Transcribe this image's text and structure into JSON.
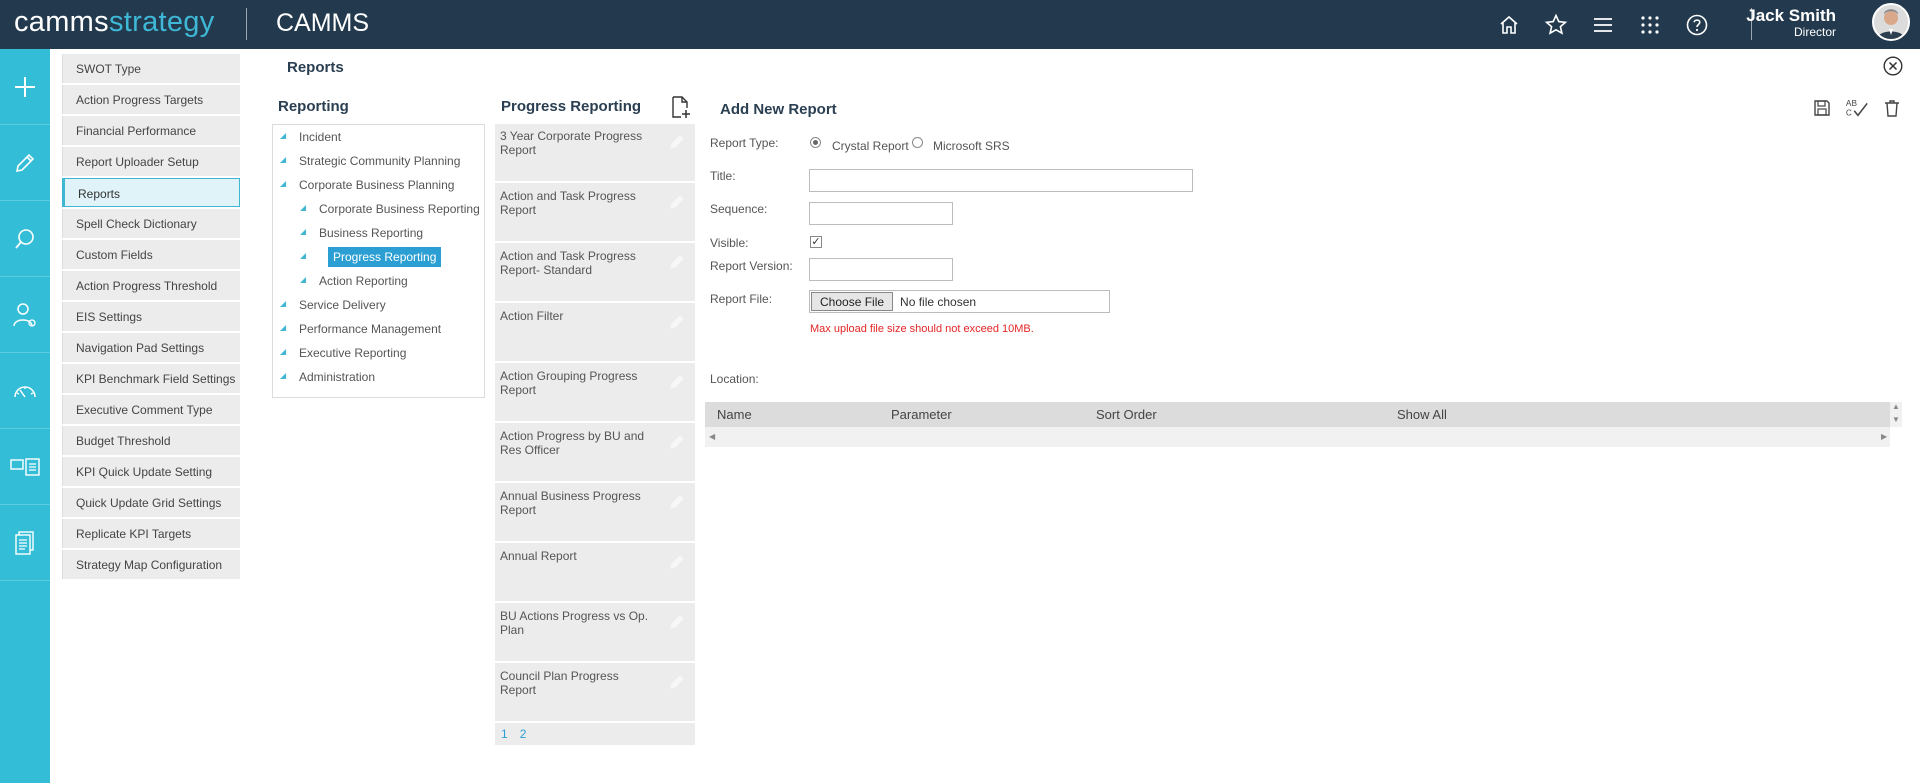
{
  "header": {
    "brand_part1": "camms",
    "brand_part2": "strategy",
    "app_name": "CAMMS",
    "user_name": "Jack Smith",
    "user_role": "Director",
    "icons": [
      "home-icon",
      "star-icon",
      "menu-icon",
      "apps-grid-icon",
      "help-icon"
    ]
  },
  "rail": {
    "icons": [
      "plus-icon",
      "pencil-icon",
      "search-icon",
      "user-settings-icon",
      "gauge-icon",
      "cards-icon",
      "document-icon"
    ]
  },
  "settings_menu": {
    "items": [
      {
        "label": "SWOT Type",
        "active": false
      },
      {
        "label": "Action Progress Targets",
        "active": false
      },
      {
        "label": "Financial Performance",
        "active": false
      },
      {
        "label": "Report Uploader Setup",
        "active": false
      },
      {
        "label": "Reports",
        "active": true
      },
      {
        "label": "Spell Check Dictionary",
        "active": false
      },
      {
        "label": "Custom Fields",
        "active": false
      },
      {
        "label": "Action Progress Threshold",
        "active": false
      },
      {
        "label": "EIS Settings",
        "active": false
      },
      {
        "label": "Navigation Pad Settings",
        "active": false
      },
      {
        "label": "KPI Benchmark Field Settings",
        "active": false
      },
      {
        "label": "Executive Comment Type",
        "active": false
      },
      {
        "label": "Budget Threshold",
        "active": false
      },
      {
        "label": "KPI Quick Update Setting",
        "active": false
      },
      {
        "label": "Quick Update Grid Settings",
        "active": false
      },
      {
        "label": "Replicate KPI Targets",
        "active": false
      },
      {
        "label": "Strategy Map Configuration",
        "active": false
      }
    ]
  },
  "page": {
    "title": "Reports"
  },
  "reporting_tree": {
    "title": "Reporting",
    "items": [
      {
        "label": "Incident",
        "level": 0
      },
      {
        "label": "Strategic Community Planning",
        "level": 0
      },
      {
        "label": "Corporate Business Planning",
        "level": 0
      },
      {
        "label": "Corporate Business Reporting",
        "level": 1
      },
      {
        "label": "Business Reporting",
        "level": 1
      },
      {
        "label": "Progress Reporting",
        "level": 1,
        "selected": true
      },
      {
        "label": "Action Reporting",
        "level": 1
      },
      {
        "label": "Service Delivery",
        "level": 0
      },
      {
        "label": "Performance Management",
        "level": 0
      },
      {
        "label": "Executive Reporting",
        "level": 0
      },
      {
        "label": "Administration",
        "level": 0
      }
    ]
  },
  "report_list": {
    "title": "Progress Reporting",
    "items": [
      "3 Year Corporate Progress Report",
      "Action and Task Progress Report",
      "Action and Task Progress Report- Standard",
      "Action Filter",
      "Action Grouping Progress Report",
      "Action Progress by BU and Res Officer",
      "Annual Business Progress Report",
      "Annual Report",
      "BU Actions Progress vs Op. Plan",
      "Council Plan Progress Report"
    ],
    "pages": [
      "1",
      "2"
    ]
  },
  "form": {
    "title": "Add New Report",
    "report_type_label": "Report Type:",
    "report_type_options": [
      "Crystal Report",
      "Microsoft SRS"
    ],
    "report_type_selected": "Crystal Report",
    "title_label": "Title:",
    "title_value": "",
    "sequence_label": "Sequence:",
    "sequence_value": "",
    "visible_label": "Visible:",
    "visible_checked": true,
    "version_label": "Report Version:",
    "version_value": "",
    "file_label": "Report File:",
    "file_button": "Choose File",
    "file_status": "No file chosen",
    "upload_note": "Max upload file size should not exceed 10MB.",
    "location_label": "Location:",
    "tool_icons": [
      "save-icon",
      "spellcheck-icon",
      "trash-icon"
    ],
    "grid_columns": [
      "Name",
      "Parameter",
      "Sort Order",
      "Show All"
    ]
  }
}
